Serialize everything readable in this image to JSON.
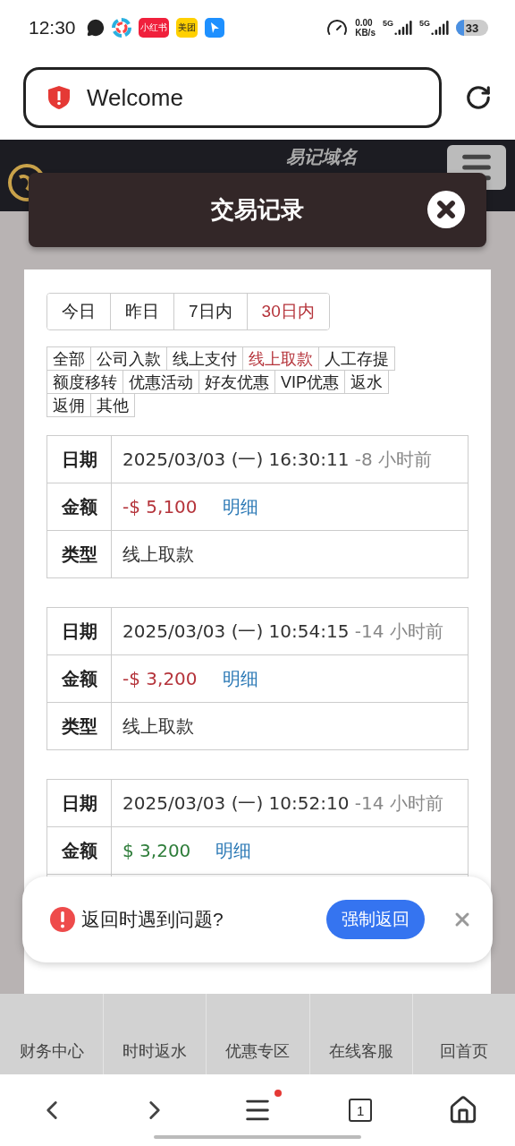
{
  "status_bar": {
    "time": "12:30",
    "app_icons": [
      {
        "kind": "chat"
      },
      {
        "kind": "pinwheel"
      },
      {
        "kind": "label",
        "label": "小红书",
        "color": "#f0203c"
      },
      {
        "kind": "label",
        "label": "美团",
        "color": "#ffd000"
      },
      {
        "kind": "pin",
        "color": "#1e90ff"
      }
    ],
    "speed_value": "0.00",
    "speed_unit": "KB/s",
    "networks": [
      "5G",
      "5G"
    ],
    "battery": "33"
  },
  "address_bar": {
    "title": "Welcome"
  },
  "site_header": {
    "domain_label": "易记域名"
  },
  "modal": {
    "title": "交易记录"
  },
  "date_filters": [
    {
      "label": "今日",
      "selected": false
    },
    {
      "label": "昨日",
      "selected": false
    },
    {
      "label": "7日内",
      "selected": false
    },
    {
      "label": "30日内",
      "selected": true
    }
  ],
  "category_filters": [
    [
      {
        "label": "全部",
        "selected": false
      },
      {
        "label": "公司入款",
        "selected": false
      },
      {
        "label": "线上支付",
        "selected": false
      },
      {
        "label": "线上取款",
        "selected": true
      },
      {
        "label": "人工存提",
        "selected": false
      }
    ],
    [
      {
        "label": "额度移转",
        "selected": false
      },
      {
        "label": "优惠活动",
        "selected": false
      },
      {
        "label": "好友优惠",
        "selected": false
      },
      {
        "label": "VIP优惠",
        "selected": false
      },
      {
        "label": "返水",
        "selected": false
      }
    ],
    [
      {
        "label": "返佣",
        "selected": false
      },
      {
        "label": "其他",
        "selected": false
      }
    ]
  ],
  "records": [
    {
      "date_label": "日期",
      "date": "2025/03/03 (一) 16:30:11",
      "ago": "-8 小时前",
      "amount_label": "金额",
      "amount": "-$ 5,100",
      "color": "#b5343b",
      "detail_link": "明细",
      "type_label": "类型",
      "type": "线上取款"
    },
    {
      "date_label": "日期",
      "date": "2025/03/03 (一) 10:54:15",
      "ago": "-14 小时前",
      "amount_label": "金额",
      "amount": "-$ 3,200",
      "color": "#b5343b",
      "detail_link": "明细",
      "type_label": "类型",
      "type": "线上取款"
    },
    {
      "date_label": "日期",
      "date": "2025/03/03 (一) 10:52:10",
      "ago": "-14 小时前",
      "amount_label": "金额",
      "amount": "$ 3,200",
      "color": "#2e7d3a",
      "detail_link": "明细"
    }
  ],
  "site_nav": [
    "财务中心",
    "时时返水",
    "优惠专区",
    "在线客服",
    "回首页"
  ],
  "toast": {
    "message": "返回时遇到问题?",
    "button": "强制返回"
  },
  "browser_bar": {
    "tab_count": "1",
    "menu_badge": true
  }
}
